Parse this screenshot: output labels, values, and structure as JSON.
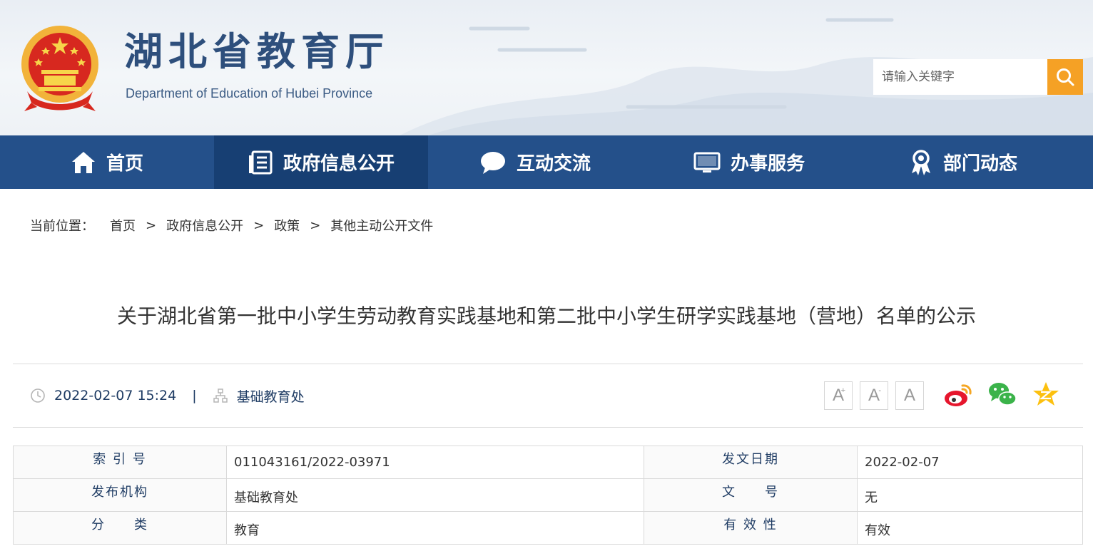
{
  "header": {
    "title": "湖北省教育厅",
    "subtitle": "Department of Education of Hubei Province",
    "search_placeholder": "请输入关键字"
  },
  "nav": [
    {
      "label": "首页",
      "icon": "home-icon"
    },
    {
      "label": "政府信息公开",
      "icon": "document-list-icon",
      "active": true
    },
    {
      "label": "互动交流",
      "icon": "chat-bubble-icon"
    },
    {
      "label": "办事服务",
      "icon": "monitor-icon"
    },
    {
      "label": "部门动态",
      "icon": "award-ribbon-icon"
    }
  ],
  "breadcrumb": {
    "label": "当前位置：",
    "items": [
      "首页",
      "政府信息公开",
      "政策",
      "其他主动公开文件"
    ],
    "separator": ">"
  },
  "article": {
    "title": "关于湖北省第一批中小学生劳动教育实践基地和第二批中小学生研学实践基地（营地）名单的公示",
    "datetime": "2022-02-07 15:24",
    "meta_separator": "|",
    "department": "基础教育处"
  },
  "font_controls": {
    "increase": "A",
    "increase_mark": "+",
    "decrease": "A",
    "decrease_mark": "-",
    "reset": "A"
  },
  "info_table": {
    "rows": [
      [
        {
          "key": "索 引 号",
          "value": "011043161/2022-03971"
        },
        {
          "key": "发文日期",
          "value": "2022-02-07"
        }
      ],
      [
        {
          "key": "发布机构",
          "value": "基础教育处"
        },
        {
          "key": "文　　号",
          "value": "无"
        }
      ],
      [
        {
          "key": "分　　类",
          "value": "教育"
        },
        {
          "key": "有 效 性",
          "value": "有效"
        }
      ]
    ]
  },
  "colors": {
    "nav_bg": "#24508a",
    "nav_active": "#173f73",
    "search_button": "#f5a125",
    "title_blue": "#2e4f7c"
  }
}
